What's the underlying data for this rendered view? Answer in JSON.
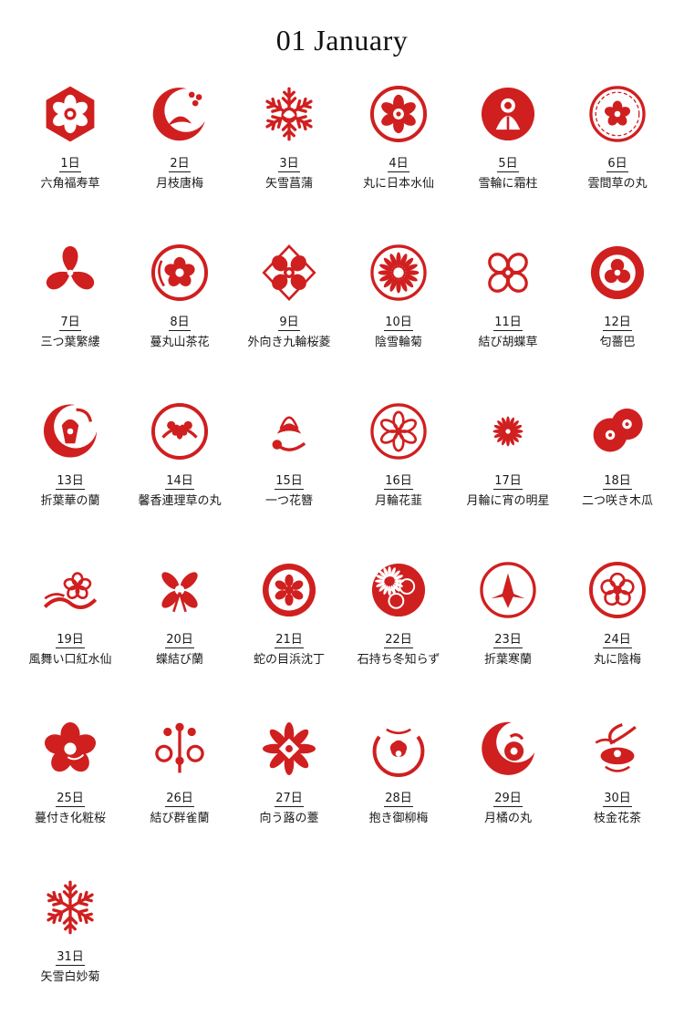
{
  "page": {
    "title": "01  January"
  },
  "colors": {
    "crest": "#d01f1f",
    "text": "#1a1a1a"
  },
  "days": [
    {
      "day": "1日",
      "name": "六角福寿草",
      "icon": "hexagon-flower-crest"
    },
    {
      "day": "2日",
      "name": "月枝唐梅",
      "icon": "moon-plum-branch-crest"
    },
    {
      "day": "3日",
      "name": "矢雪菖蒲",
      "icon": "snow-iris-crest"
    },
    {
      "day": "4日",
      "name": "丸に日本水仙",
      "icon": "ring-narcissus-crest"
    },
    {
      "day": "5日",
      "name": "雪輪に霜柱",
      "icon": "snow-ring-frost-crest"
    },
    {
      "day": "6日",
      "name": "雲間草の丸",
      "icon": "cloud-flower-circle-crest"
    },
    {
      "day": "7日",
      "name": "三つ葉繁縷",
      "icon": "three-leaf-crest"
    },
    {
      "day": "8日",
      "name": "蔓丸山茶花",
      "icon": "vine-camellia-circle-crest"
    },
    {
      "day": "9日",
      "name": "外向き九輪桜菱",
      "icon": "cherry-diamond-crest"
    },
    {
      "day": "10日",
      "name": "陰雪輪菊",
      "icon": "snow-chrysanthemum-crest"
    },
    {
      "day": "11日",
      "name": "結び胡蝶草",
      "icon": "knot-butterfly-flower-crest"
    },
    {
      "day": "12日",
      "name": "匂薔巴",
      "icon": "tomoe-rose-crest"
    },
    {
      "day": "13日",
      "name": "折葉華の蘭",
      "icon": "folded-leaf-orchid-crest"
    },
    {
      "day": "14日",
      "name": "馨香連理草の丸",
      "icon": "fragrant-vine-circle-crest"
    },
    {
      "day": "15日",
      "name": "一つ花簪",
      "icon": "flower-hairpin-crest"
    },
    {
      "day": "16日",
      "name": "月輪花韮",
      "icon": "moon-ring-flower-crest"
    },
    {
      "day": "17日",
      "name": "月輪に宵の明星",
      "icon": "moon-evening-star-crest"
    },
    {
      "day": "18日",
      "name": "二つ咲き木瓜",
      "icon": "double-quince-crest"
    },
    {
      "day": "19日",
      "name": "風舞い口紅水仙",
      "icon": "wind-narcissus-crest"
    },
    {
      "day": "20日",
      "name": "蝶結び蘭",
      "icon": "bow-orchid-crest"
    },
    {
      "day": "21日",
      "name": "蛇の目浜沈丁",
      "icon": "snake-eye-daphne-crest"
    },
    {
      "day": "22日",
      "name": "石持ち冬知らず",
      "icon": "stone-chrysanthemum-crest"
    },
    {
      "day": "23日",
      "name": "折葉寒蘭",
      "icon": "folded-winter-orchid-crest"
    },
    {
      "day": "24日",
      "name": "丸に陰梅",
      "icon": "ring-plum-crest"
    },
    {
      "day": "25日",
      "name": "蔓付き化粧桜",
      "icon": "vine-cherry-crest"
    },
    {
      "day": "26日",
      "name": "結び群雀蘭",
      "icon": "knot-sparrow-orchid-crest"
    },
    {
      "day": "27日",
      "name": "向う蕗の薹",
      "icon": "butterbur-bud-crest"
    },
    {
      "day": "28日",
      "name": "抱き御柳梅",
      "icon": "embraced-plum-crest"
    },
    {
      "day": "29日",
      "name": "月橘の丸",
      "icon": "moon-orange-circle-crest"
    },
    {
      "day": "30日",
      "name": "枝金花茶",
      "icon": "golden-camellia-branch-crest"
    },
    {
      "day": "31日",
      "name": "矢雪白妙菊",
      "icon": "snowflake-crest"
    }
  ]
}
